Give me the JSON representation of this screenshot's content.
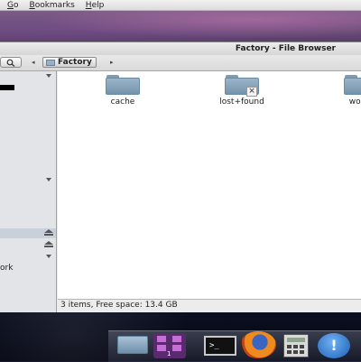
{
  "menubar": {
    "items": [
      "Go",
      "Bookmarks",
      "Help"
    ]
  },
  "window": {
    "title": "Factory - File Browser"
  },
  "toolbar": {
    "search_icon": "search-icon",
    "back_arrow": "◂",
    "location_crumb": "Factory",
    "forward_arrow": "▸"
  },
  "sidebar": {
    "partial_label": "ork"
  },
  "files": [
    {
      "name": "cache",
      "icon": "folder-icon"
    },
    {
      "name": "lost+found",
      "icon": "folder-restricted-icon"
    },
    {
      "name": "works",
      "icon": "folder-icon"
    }
  ],
  "status": {
    "text": "3 items, Free space: 13.4 GB"
  },
  "dock": {
    "items": [
      {
        "name": "file-browser",
        "icon": "folder-icon"
      },
      {
        "name": "applications",
        "icon": "apps-grid-icon",
        "badge": "1"
      },
      {
        "name": "terminal",
        "icon": "terminal-icon",
        "glyph": ">_"
      },
      {
        "name": "firefox",
        "icon": "firefox-icon"
      },
      {
        "name": "calculator",
        "icon": "calculator-icon"
      },
      {
        "name": "help",
        "icon": "help-icon",
        "glyph": "!"
      }
    ]
  },
  "colors": {
    "folder": "#7d9bb3",
    "selection": "#c7d0db",
    "window_bg": "#ececec"
  }
}
